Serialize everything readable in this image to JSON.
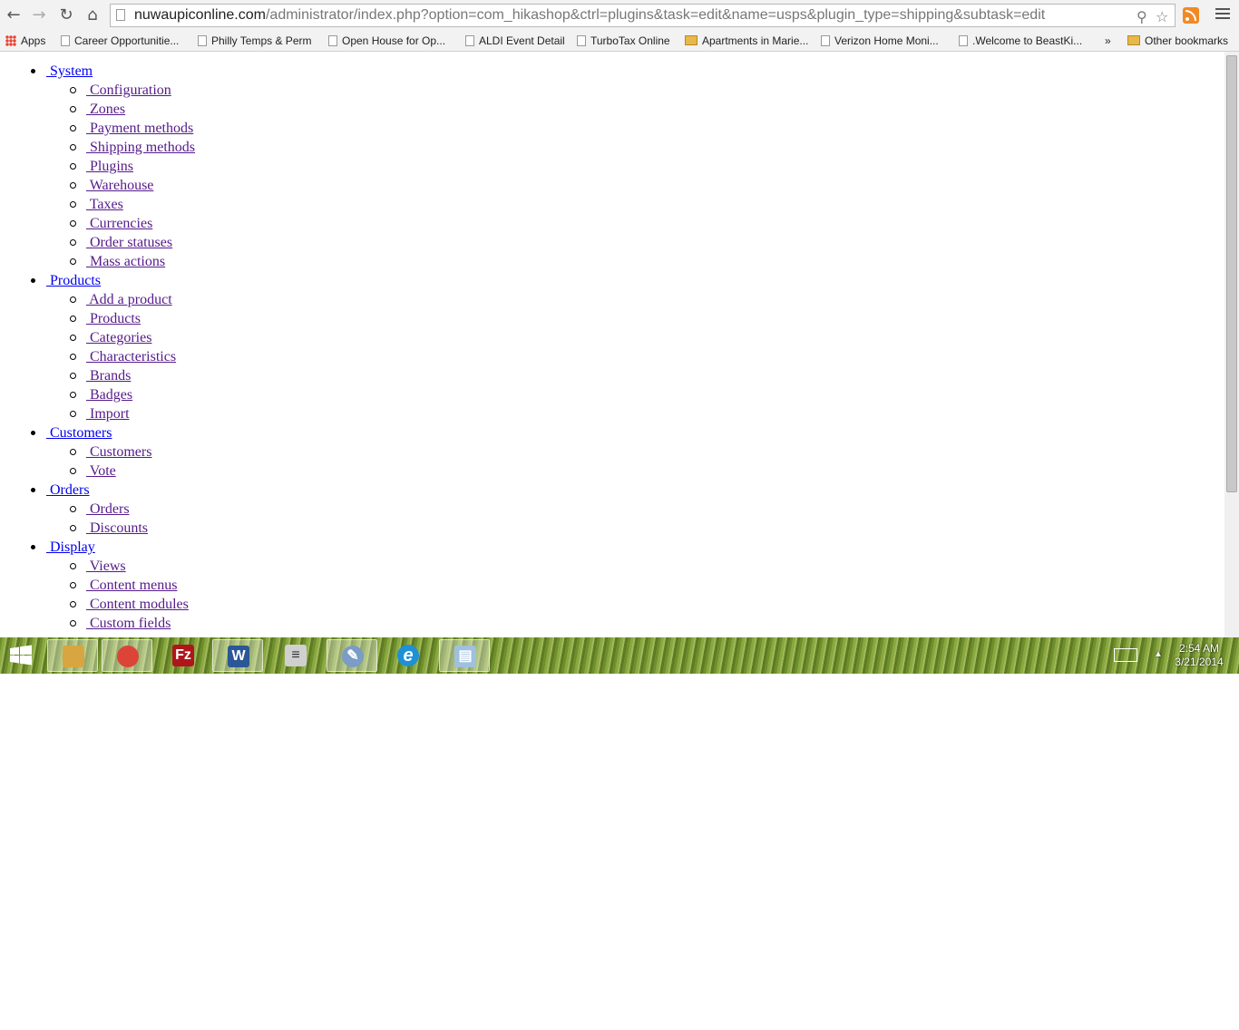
{
  "browser": {
    "url_host": "nuwaupiconline.com",
    "url_path": "/administrator/index.php?option=com_hikashop&ctrl=plugins&task=edit&name=usps&plugin_type=shipping&subtask=edit",
    "bookmarks": [
      {
        "label": "Apps",
        "icon": "apps-icon"
      },
      {
        "label": "Career Opportunitie...",
        "icon": "page-icon"
      },
      {
        "label": "Philly Temps & Perm",
        "icon": "page-icon"
      },
      {
        "label": "Open House for Op...",
        "icon": "page-icon"
      },
      {
        "label": "ALDI Event Detail",
        "icon": "page-icon"
      },
      {
        "label": "TurboTax Online",
        "icon": "page-icon"
      },
      {
        "label": "Apartments in Marie...",
        "icon": "folder-icon"
      },
      {
        "label": "Verizon Home Moni...",
        "icon": "page-icon"
      },
      {
        "label": ".Welcome to BeastKi...",
        "icon": "page-icon"
      }
    ],
    "overflow": "»",
    "other_bookmarks": "Other bookmarks"
  },
  "menu": {
    "sections": [
      {
        "label": " System",
        "items": [
          " Configuration",
          " Zones",
          " Payment methods",
          " Shipping methods",
          " Plugins",
          " Warehouse",
          " Taxes",
          " Currencies",
          " Order statuses",
          " Mass actions"
        ]
      },
      {
        "label": " Products",
        "items": [
          " Add a product",
          " Products",
          " Categories",
          " Characteristics",
          " Brands",
          " Badges",
          " Import"
        ]
      },
      {
        "label": " Customers",
        "items": [
          " Customers",
          " Vote"
        ]
      },
      {
        "label": " Orders",
        "items": [
          " Orders",
          " Discounts"
        ]
      },
      {
        "label": " Display",
        "items": [
          " Views",
          " Content menus",
          " Content modules",
          " Custom fields"
        ]
      }
    ]
  },
  "taskbar": {
    "time": "2:54 AM",
    "date": "3/21/2014",
    "apps": [
      {
        "name": "file-explorer-icon",
        "glyph": "",
        "color": "#d8a640"
      },
      {
        "name": "chrome-icon",
        "glyph": "",
        "color": "#db4437",
        "active": true
      },
      {
        "name": "filezilla-icon",
        "glyph": "Fz",
        "color": "#b0151c"
      },
      {
        "name": "word-icon",
        "glyph": "W",
        "color": "#2b5797"
      },
      {
        "name": "server-manager-icon",
        "glyph": "≡",
        "color": "#d0d0d0"
      },
      {
        "name": "paint-icon",
        "glyph": "✎",
        "color": "#7a9cc6"
      },
      {
        "name": "internet-explorer-icon",
        "glyph": "e",
        "color": "#1e90d6"
      },
      {
        "name": "notepad-icon",
        "glyph": "▤",
        "color": "#9fc0de"
      }
    ]
  }
}
